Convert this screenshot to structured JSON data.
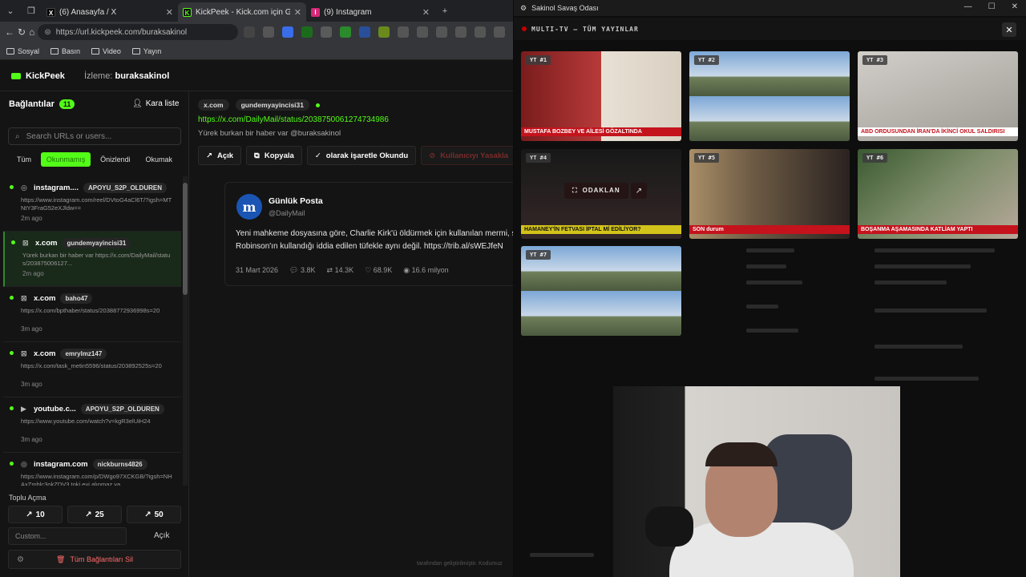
{
  "browser": {
    "tabs": [
      {
        "label": "(6) Anasayfa / X",
        "favicon": "X",
        "color": "#000000",
        "active": false
      },
      {
        "label": "KickPeek - Kick.com için Gerçek Zamanlı",
        "favicon": "K",
        "color": "#53fc18",
        "active": true
      },
      {
        "label": "(9) Instagram",
        "favicon": "I",
        "color": "#d62976",
        "active": false
      }
    ],
    "new_tab": "+",
    "url": "https://url.kickpeek.com/buraksakinol",
    "bookmarks": [
      "Sosyal",
      "Basın",
      "Video",
      "Yayın"
    ]
  },
  "app": {
    "logo": "KickPeek",
    "watching_label": "İzleme:",
    "watching_user": "buraksakinol",
    "accent": "#53fc18"
  },
  "sidebar": {
    "title": "Bağlantılar",
    "count": "11",
    "blacklist": "Kara liste",
    "search_placeholder": "Search URLs or users...",
    "filters": [
      "Tüm",
      "Okunmamış",
      "Önizlendi",
      "Okumak"
    ],
    "items": [
      {
        "site": "instagram....",
        "icon": "instagram-icon",
        "user": "APOYU_S2P_OLDUREN",
        "url": "https://www.instagram.com/reel/DVtoG4aCl6T/?igsh=MTNtY3FraG52eXJldw==",
        "time": "2m ago",
        "selected": false,
        "unread": true
      },
      {
        "site": "x.com",
        "icon": "x-icon",
        "user": "gundemyayincisi31",
        "url": "Yürek burkan bir haber var https://x.com/DailyMail/status/203875006127...",
        "time": "2m ago",
        "selected": true,
        "unread": true
      },
      {
        "site": "x.com",
        "icon": "x-icon",
        "user": "baho47",
        "url": "https://x.com/bpthaber/status/20388772936998s=20",
        "time": "3m ago",
        "selected": false,
        "unread": true
      },
      {
        "site": "x.com",
        "icon": "x-icon",
        "user": "emrylmz147",
        "url": "https://x.com/task_metin5596/status/203892525s=20",
        "time": "3m ago",
        "selected": false,
        "unread": true
      },
      {
        "site": "youtube.c...",
        "icon": "youtube-icon",
        "user": "APOYU_S2P_OLDUREN",
        "url": "https://www.youtube.com/watch?v=kgR3elUiH24",
        "time": "3m ago",
        "selected": false,
        "unread": true
      },
      {
        "site": "instagram.com",
        "icon": "instagram-icon",
        "user": "nickburns4826",
        "url": "https://www.instagram.com/p/DWgo97XCKGB/?igsh=NHAxZmhlc3okZDV3 toki evi alınmaz ya",
        "time": "",
        "selected": false,
        "unread": true
      }
    ],
    "bulk_label": "Toplu Açma",
    "bulk_buttons": [
      "10",
      "25",
      "50"
    ],
    "custom_placeholder": "Custom...",
    "custom_open": "Açık",
    "delete_all": "Tüm Bağlantıları Sil"
  },
  "detail": {
    "source": "x.com",
    "user": "gundemyayincisi31",
    "link": "https://x.com/DailyMail/status/2038750061274734986",
    "message": "Yürek burkan bir haber var @buraksakinol",
    "actions": [
      "Açık",
      "Kopyala",
      "olarak işaretle Okundu",
      "Kullanıcıyı Yasakla"
    ],
    "tweet": {
      "name": "Günlük Posta",
      "handle": "@DailyMail",
      "avatar": "m",
      "text1": "Yeni mahkeme dosyasına göre, Charlie Kirk'ü öldürmek için kullanılan mermi, şüpheli",
      "text2": "Robinson'ın kullandığı iddia edilen tüfekle aynı değil. https://trib.al/sWEJfeN",
      "date": "31 Mart 2026",
      "replies": "3.8K",
      "retweets": "14.3K",
      "likes": "68.9K",
      "views": "16.6 milyon"
    },
    "credit": "tarafından geliştirilmiştir. Kodumuz"
  },
  "overlay": {
    "window_title": "Sakinol Savaş Odası",
    "bar_label": "MULTI-TV — TÜM YAYINLAR",
    "tiles": [
      {
        "tag": "YT #1",
        "caption": "MUSTAFA BOZBEY VE AİLESİ GÖZALTINDA"
      },
      {
        "tag": "YT #2",
        "caption": ""
      },
      {
        "tag": "YT #3",
        "caption": "ABD ORDUSUNDAN İRAN'DA İKİNCİ OKUL SALDIRISI"
      },
      {
        "tag": "YT #4",
        "caption": "HAMANEY'İN FETVASI İPTAL Mİ EDİLİYOR?"
      },
      {
        "tag": "YT #5",
        "caption": "SON durum"
      },
      {
        "tag": "YT #6",
        "caption": "BOŞANMA AŞAMASINDA KATLİAM YAPTI"
      },
      {
        "tag": "YT #7",
        "caption": ""
      }
    ],
    "focus_label": "ODAKLAN"
  }
}
